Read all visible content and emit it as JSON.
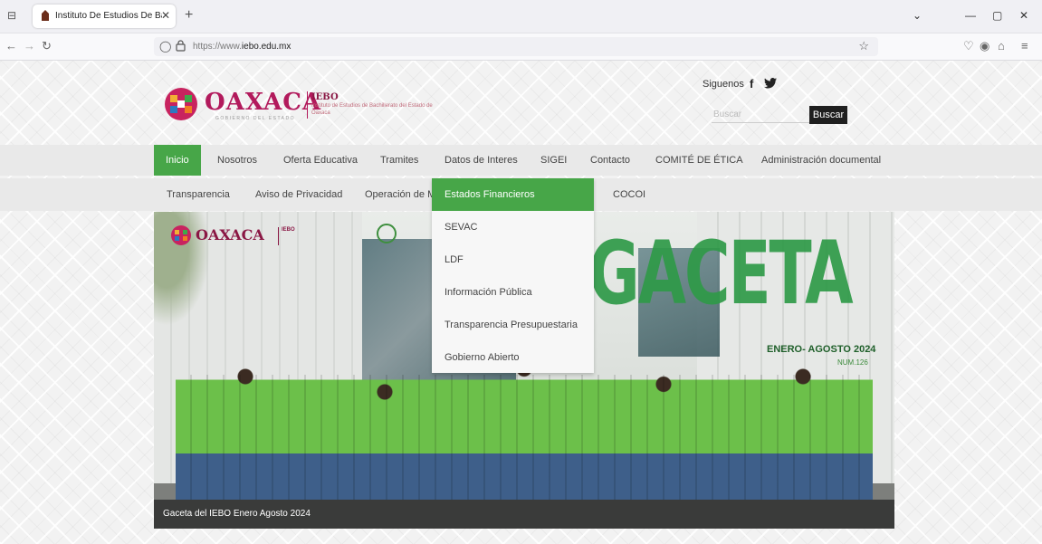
{
  "browser": {
    "tab_title": "Instituto De Estudios De Bachill",
    "url_prefix": "https://www.",
    "url_domain": "iebo.edu.mx"
  },
  "header": {
    "logo_main": "OAXACA",
    "logo_sub": "GOBIERNO DEL ESTADO",
    "logo_acronym": "IEBO",
    "logo_fullname": "Instituto de Estudios de Bachillerato del Estado de Oaxaca",
    "social_label": "Siguenos",
    "social_fb": "f",
    "search_placeholder": "Buscar",
    "search_button": "Buscar"
  },
  "menu": {
    "row1": [
      "Inicio",
      "Nosotros",
      "Oferta Educativa",
      "Tramites",
      "Datos de Interes",
      "SIGEI",
      "Contacto",
      "COMITÉ DE ÉTICA",
      "Administración documental"
    ],
    "row2": [
      "Transparencia",
      "Aviso de Privacidad",
      "Operación de M",
      "COCOI"
    ],
    "active": "Inicio"
  },
  "dropdown": {
    "items": [
      "Estados Financieros",
      "SEVAC",
      "LDF",
      "Información Pública",
      "Transparencia Presupuestaria",
      "Gobierno Abierto"
    ],
    "highlighted": "Estados Financieros"
  },
  "hero": {
    "logo_main": "OAXACA",
    "logo_acronym": "IEBO",
    "title": "GACETA",
    "date": "ENERO- AGOSTO 2024",
    "number": "NUM.126",
    "caption": "Gaceta del IEBO Enero Agosto 2024"
  },
  "colors": {
    "accent_green": "#47a648",
    "brand_magenta": "#b21a5c",
    "menu_bg": "#e9e9e9"
  }
}
